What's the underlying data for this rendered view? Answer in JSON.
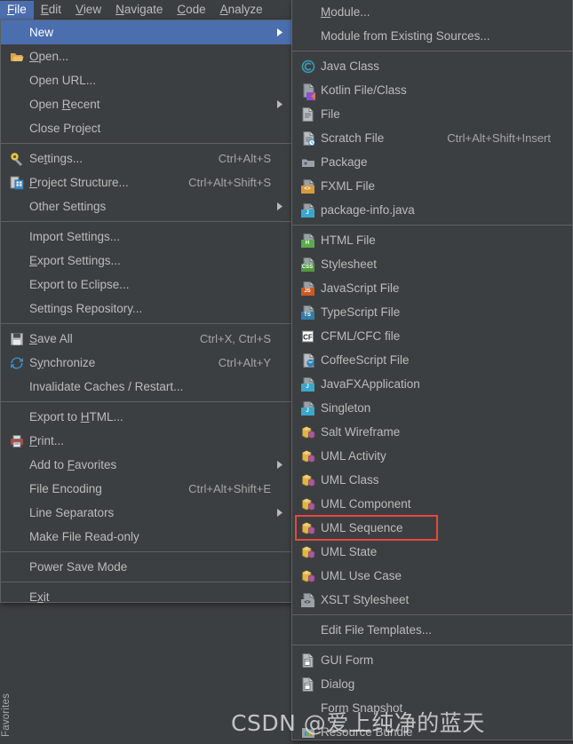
{
  "menubar": {
    "items": [
      {
        "label": "File",
        "mnemonic": "F",
        "active": true
      },
      {
        "label": "Edit",
        "mnemonic": "E",
        "active": false
      },
      {
        "label": "View",
        "mnemonic": "V",
        "active": false
      },
      {
        "label": "Navigate",
        "mnemonic": "N",
        "active": false
      },
      {
        "label": "Code",
        "mnemonic": "C",
        "active": false
      },
      {
        "label": "Analyze",
        "mnemonic": "A",
        "active": false
      }
    ]
  },
  "toolwindow": {
    "favorites_label": "Favorites"
  },
  "file_menu": {
    "items": [
      {
        "label": "New",
        "icon": "none",
        "selected": true,
        "submenu": true,
        "shortcut": ""
      },
      {
        "label": "Open...",
        "icon": "folder-open-icon",
        "shortcut": "",
        "submenu": false
      },
      {
        "label": "Open URL...",
        "icon": "none",
        "shortcut": "",
        "submenu": false
      },
      {
        "label": "Open Recent",
        "icon": "none",
        "shortcut": "",
        "submenu": true
      },
      {
        "label": "Close Project",
        "icon": "none",
        "shortcut": "",
        "submenu": false
      },
      {
        "separator": true
      },
      {
        "label": "Settings...",
        "icon": "gear-icon",
        "shortcut": "Ctrl+Alt+S",
        "submenu": false
      },
      {
        "label": "Project Structure...",
        "icon": "project-structure-icon",
        "shortcut": "Ctrl+Alt+Shift+S",
        "submenu": false
      },
      {
        "label": "Other Settings",
        "icon": "none",
        "shortcut": "",
        "submenu": true
      },
      {
        "separator": true
      },
      {
        "label": "Import Settings...",
        "icon": "none",
        "shortcut": "",
        "submenu": false
      },
      {
        "label": "Export Settings...",
        "icon": "none",
        "shortcut": "",
        "submenu": false
      },
      {
        "label": "Export to Eclipse...",
        "icon": "none",
        "shortcut": "",
        "submenu": false
      },
      {
        "label": "Settings Repository...",
        "icon": "none",
        "shortcut": "",
        "submenu": false
      },
      {
        "separator": true
      },
      {
        "label": "Save All",
        "icon": "save-icon",
        "shortcut": "Ctrl+X, Ctrl+S",
        "submenu": false
      },
      {
        "label": "Synchronize",
        "icon": "synchronize-icon",
        "shortcut": "Ctrl+Alt+Y",
        "submenu": false
      },
      {
        "label": "Invalidate Caches / Restart...",
        "icon": "none",
        "shortcut": "",
        "submenu": false
      },
      {
        "separator": true
      },
      {
        "label": "Export to HTML...",
        "icon": "none",
        "shortcut": "",
        "submenu": false
      },
      {
        "label": "Print...",
        "icon": "print-icon",
        "shortcut": "",
        "submenu": false
      },
      {
        "label": "Add to Favorites",
        "icon": "none",
        "shortcut": "",
        "submenu": true
      },
      {
        "label": "File Encoding",
        "icon": "none",
        "shortcut": "Ctrl+Alt+Shift+E",
        "submenu": false
      },
      {
        "label": "Line Separators",
        "icon": "none",
        "shortcut": "",
        "submenu": true
      },
      {
        "label": "Make File Read-only",
        "icon": "none",
        "shortcut": "",
        "submenu": false
      },
      {
        "separator": true
      },
      {
        "label": "Power Save Mode",
        "icon": "none",
        "shortcut": "",
        "submenu": false
      },
      {
        "separator": true
      },
      {
        "label": "Exit",
        "icon": "none",
        "shortcut": "",
        "submenu": false
      }
    ]
  },
  "new_menu": {
    "items": [
      {
        "label": "Module...",
        "icon": "none",
        "shortcut": ""
      },
      {
        "label": "Module from Existing Sources...",
        "icon": "none",
        "shortcut": ""
      },
      {
        "separator": true
      },
      {
        "label": "Java Class",
        "icon": "java-class-icon",
        "shortcut": ""
      },
      {
        "label": "Kotlin File/Class",
        "icon": "kotlin-file-icon",
        "shortcut": ""
      },
      {
        "label": "File",
        "icon": "file-icon",
        "shortcut": ""
      },
      {
        "label": "Scratch File",
        "icon": "scratch-file-icon",
        "shortcut": "Ctrl+Alt+Shift+Insert"
      },
      {
        "label": "Package",
        "icon": "package-icon",
        "shortcut": ""
      },
      {
        "label": "FXML File",
        "icon": "fxml-file-icon",
        "shortcut": ""
      },
      {
        "label": "package-info.java",
        "icon": "package-info-icon",
        "shortcut": ""
      },
      {
        "separator": true
      },
      {
        "label": "HTML File",
        "icon": "html-file-icon",
        "shortcut": ""
      },
      {
        "label": "Stylesheet",
        "icon": "css-file-icon",
        "shortcut": ""
      },
      {
        "label": "JavaScript File",
        "icon": "js-file-icon",
        "shortcut": ""
      },
      {
        "label": "TypeScript File",
        "icon": "ts-file-icon",
        "shortcut": ""
      },
      {
        "label": "CFML/CFC file",
        "icon": "cfml-file-icon",
        "shortcut": ""
      },
      {
        "label": "CoffeeScript File",
        "icon": "coffeescript-file-icon",
        "shortcut": ""
      },
      {
        "label": "JavaFXApplication",
        "icon": "javafx-app-icon",
        "shortcut": ""
      },
      {
        "label": "Singleton",
        "icon": "singleton-icon",
        "shortcut": ""
      },
      {
        "label": "Salt Wireframe",
        "icon": "uml-diagram-icon",
        "shortcut": ""
      },
      {
        "label": "UML Activity",
        "icon": "uml-diagram-icon",
        "shortcut": ""
      },
      {
        "label": "UML Class",
        "icon": "uml-diagram-icon",
        "shortcut": ""
      },
      {
        "label": "UML Component",
        "icon": "uml-diagram-icon",
        "shortcut": ""
      },
      {
        "label": "UML Sequence",
        "icon": "uml-diagram-icon",
        "shortcut": "",
        "highlighted": true
      },
      {
        "label": "UML State",
        "icon": "uml-diagram-icon",
        "shortcut": ""
      },
      {
        "label": "UML Use Case",
        "icon": "uml-diagram-icon",
        "shortcut": ""
      },
      {
        "label": "XSLT Stylesheet",
        "icon": "xslt-file-icon",
        "shortcut": ""
      },
      {
        "separator": true
      },
      {
        "label": "Edit File Templates...",
        "icon": "none",
        "shortcut": ""
      },
      {
        "separator": true
      },
      {
        "label": "GUI Form",
        "icon": "gui-form-icon",
        "shortcut": ""
      },
      {
        "label": "Dialog",
        "icon": "dialog-icon",
        "shortcut": ""
      },
      {
        "label": "Form Snapshot",
        "icon": "none",
        "shortcut": ""
      },
      {
        "label": "Resource Bundle",
        "icon": "resource-bundle-icon",
        "shortcut": ""
      }
    ]
  },
  "annotation": {
    "highlight_color": "#e8473f",
    "highlight_target": "UML Sequence"
  },
  "watermark": {
    "text": "CSDN @爱上纯净的蓝天"
  },
  "colors": {
    "background": "#3c3f41",
    "menu_background": "#3c3f41",
    "selection": "#4b6eaf",
    "text": "#bbbbbb",
    "separator": "#5e6060",
    "border": "#5e6060"
  }
}
